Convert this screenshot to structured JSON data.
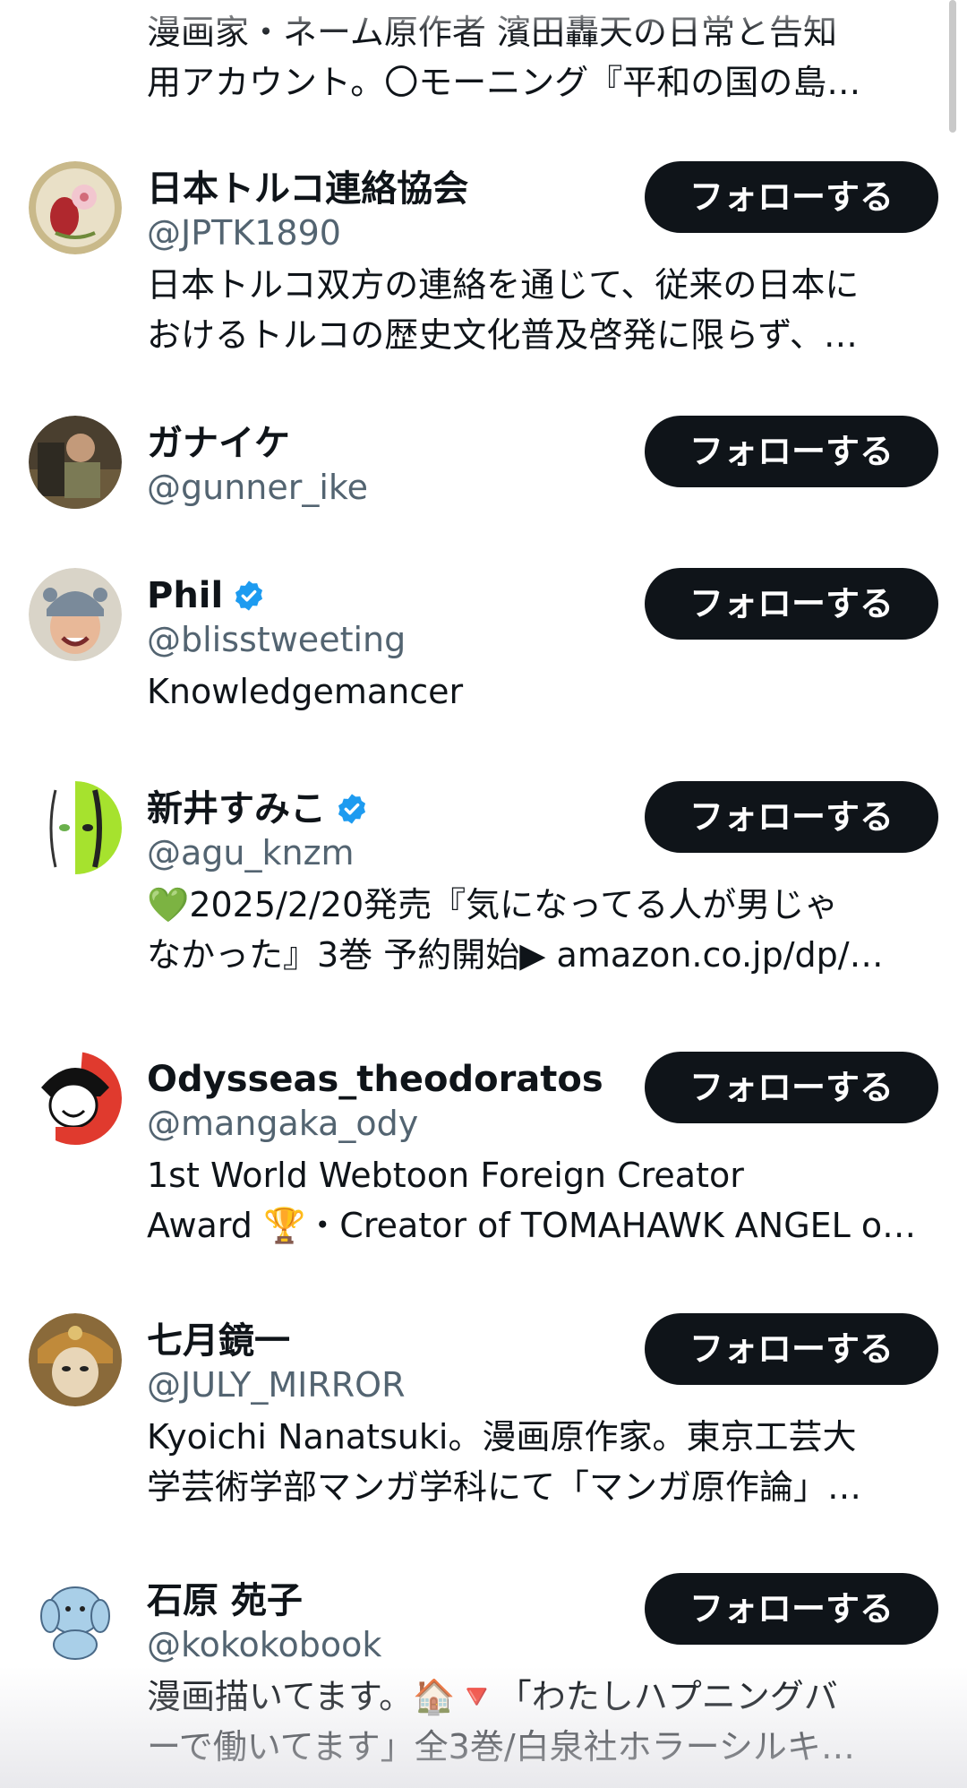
{
  "users": [
    {
      "bio_lines": [
        "漫画家・ネーム原作者 濱田轟天の日常と告知",
        "用アカウント。〇モーニング『平和の国の島…"
      ]
    },
    {
      "name": "日本トルコ連絡協会",
      "handle": "@JPTK1890",
      "follow_label": "フォローする",
      "bio_lines": [
        "日本トルコ双方の連絡を通じて、従来の日本に",
        "おけるトルコの歴史文化普及啓発に限らず、…"
      ]
    },
    {
      "name": "ガナイケ",
      "handle": "@gunner_ike",
      "follow_label": "フォローする",
      "bio_lines": []
    },
    {
      "name": "Phil",
      "verified": true,
      "handle": "@blisstweeting",
      "follow_label": "フォローする",
      "bio_lines": [
        "Knowledgemancer"
      ]
    },
    {
      "name": "新井すみこ",
      "verified": true,
      "handle": "@agu_knzm",
      "follow_label": "フォローする",
      "bio_lines": [
        "💚2025/2/20発売『気になってる人が男じゃ",
        "なかった』3巻 予約開始▶ amazon.co.jp/dp/…"
      ]
    },
    {
      "name": "Odysseas_theodoratos",
      "handle": "@mangaka_ody",
      "follow_label": "フォローする",
      "bio_lines": [
        "1st World Webtoon Foreign Creator",
        "Award 🏆・Creator of TOMAHAWK ANGEL o…"
      ]
    },
    {
      "name": "七月鏡一",
      "handle": "@JULY_MIRROR",
      "follow_label": "フォローする",
      "bio_lines": [
        "Kyoichi Nanatsuki。漫画原作家。東京工芸大",
        "学芸術学部マンガ学科にて「マンガ原作論」…"
      ]
    },
    {
      "name": "石原 苑子",
      "handle": "@kokokobook",
      "follow_label": "フォローする",
      "bio_lines": [
        "漫画描いてます。🏠🔻「わたしハプニングバ",
        "ーで働いてます」全3巻/白泉社ホラーシルキ…"
      ]
    }
  ],
  "colors": {
    "text": "#0f1419",
    "secondary": "#536471",
    "button_bg": "#0f1419",
    "button_text": "#ffffff",
    "verified": "#1d9bf0"
  },
  "icons": {
    "verified_badge": "verified-badge-icon"
  }
}
